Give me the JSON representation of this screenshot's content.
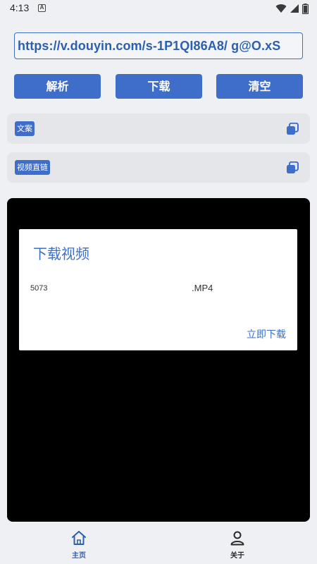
{
  "status_bar": {
    "time": "4:13",
    "notification_glyph": "A",
    "icons": [
      "wifi-icon",
      "signal-icon",
      "battery-icon"
    ]
  },
  "url_field": {
    "value": "https://v.douyin.com/s-1P1QI86A8/ g@O.xS"
  },
  "buttons": {
    "parse": "解析",
    "download": "下载",
    "clear": "清空"
  },
  "cards": [
    {
      "label": "文案",
      "icon": "copy-icon"
    },
    {
      "label": "视频直链",
      "icon": "copy-icon"
    }
  ],
  "dialog": {
    "title": "下载视频",
    "file_name": "5073",
    "file_ext": ".MP4",
    "action": "立即下载"
  },
  "bottom_nav": {
    "items": [
      {
        "label": "主页",
        "icon": "home-icon",
        "active": true
      },
      {
        "label": "关于",
        "icon": "person-icon",
        "active": false
      }
    ]
  },
  "colors": {
    "accent": "#3e6ec9",
    "accent_text": "#3d6fc4",
    "background": "#eef0f4",
    "card": "#e4e6ea",
    "media_panel": "#000000"
  }
}
